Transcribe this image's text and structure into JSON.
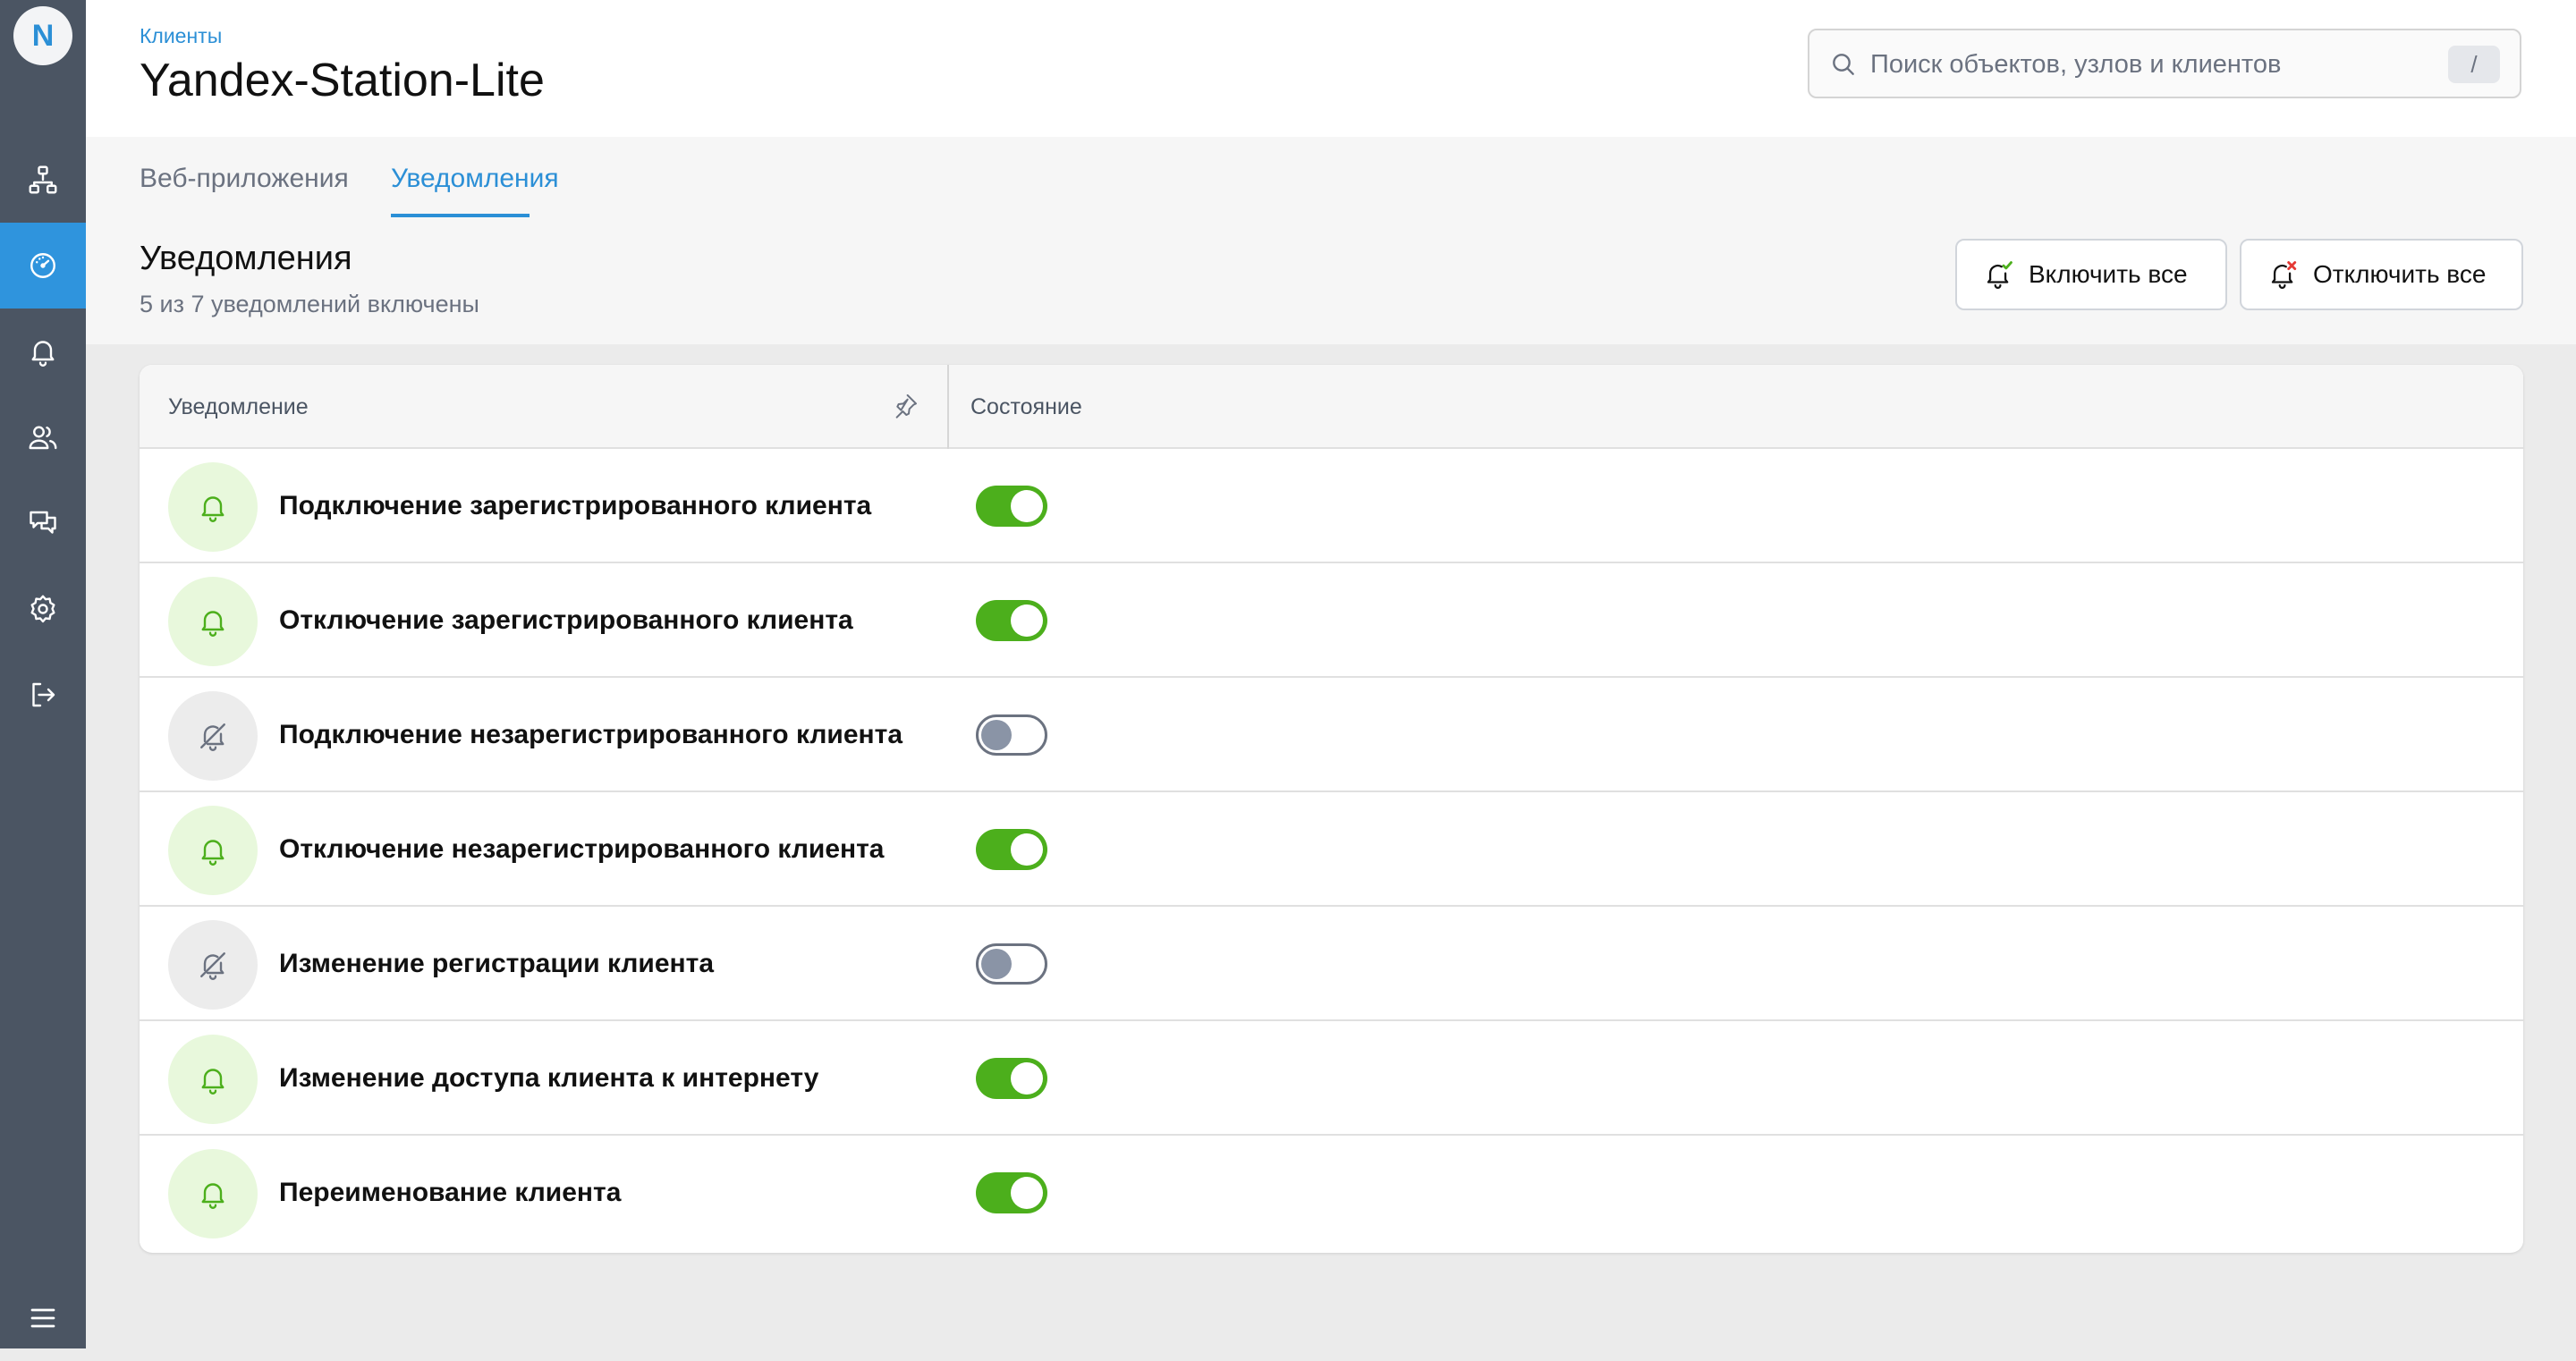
{
  "app": {
    "logo_letter": "N",
    "accent_color": "#2b8fd6",
    "sidebar_color": "#4b5563",
    "toggle_on_color": "#4caf1c"
  },
  "sidebar": {
    "items": [
      {
        "icon": "network-icon",
        "active": false
      },
      {
        "icon": "dashboard-icon",
        "active": true
      },
      {
        "icon": "bell-icon",
        "active": false
      },
      {
        "icon": "users-icon",
        "active": false
      },
      {
        "icon": "chat-icon",
        "active": false
      },
      {
        "icon": "gear-icon",
        "active": false
      },
      {
        "icon": "logout-icon",
        "active": false
      }
    ],
    "bottom_icon": "menu-icon"
  },
  "header": {
    "breadcrumb": "Клиенты",
    "title": "Yandex-Station-Lite",
    "search": {
      "placeholder": "Поиск объектов, узлов и клиентов",
      "shortcut": "/"
    }
  },
  "tabs": [
    {
      "label": "Веб-приложения",
      "active": false
    },
    {
      "label": "Уведомления",
      "active": true
    }
  ],
  "section": {
    "title": "Уведомления",
    "subtitle": "5 из 7 уведомлений включены",
    "enable_all_label": "Включить все",
    "disable_all_label": "Отключить все"
  },
  "table": {
    "columns": [
      "Уведомление",
      "Состояние"
    ],
    "rows": [
      {
        "label": "Подключение зарегистрированного клиента",
        "enabled": true
      },
      {
        "label": "Отключение зарегистрированного клиента",
        "enabled": true
      },
      {
        "label": "Подключение незарегистрированного клиента",
        "enabled": false
      },
      {
        "label": "Отключение незарегистрированного клиента",
        "enabled": true
      },
      {
        "label": "Изменение регистрации клиента",
        "enabled": false
      },
      {
        "label": "Изменение доступа клиента к интернету",
        "enabled": true
      },
      {
        "label": "Переименование клиента",
        "enabled": true
      }
    ]
  }
}
